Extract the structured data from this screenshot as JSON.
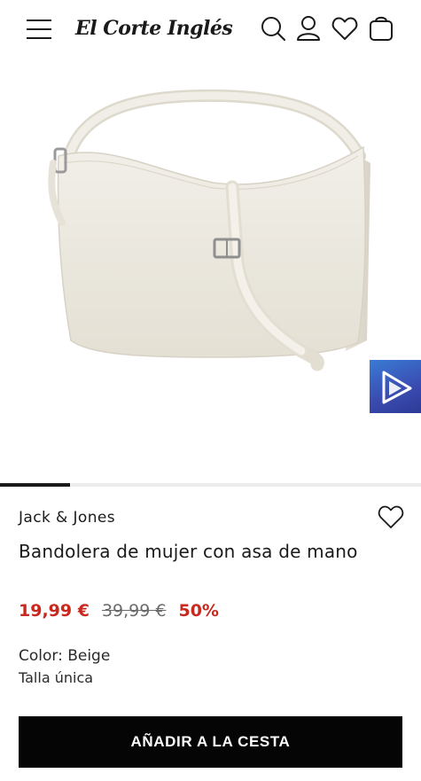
{
  "header": {
    "logo_text": "El Corte Inglés",
    "icons": [
      "menu-icon",
      "search-icon",
      "user-icon",
      "heart-icon",
      "bag-icon"
    ]
  },
  "gallery": {
    "image_alt": "Bandolera de mujer con asa de mano",
    "progress_fraction": 0.166,
    "badge_icon": "play-triangle-icon"
  },
  "product": {
    "brand": "Jack & Jones",
    "title": "Bandolera de mujer con asa de mano",
    "price_current": "19,99 €",
    "price_original": "39,99 €",
    "discount": "50%",
    "color_label": "Color: Beige",
    "size_label": "Talla única"
  },
  "cta": {
    "add_to_cart_label": "AÑADIR A LA CESTA"
  },
  "colors": {
    "sale_red": "#c8281e",
    "cta_black": "#050505",
    "bag_beige": "#ece9df"
  }
}
